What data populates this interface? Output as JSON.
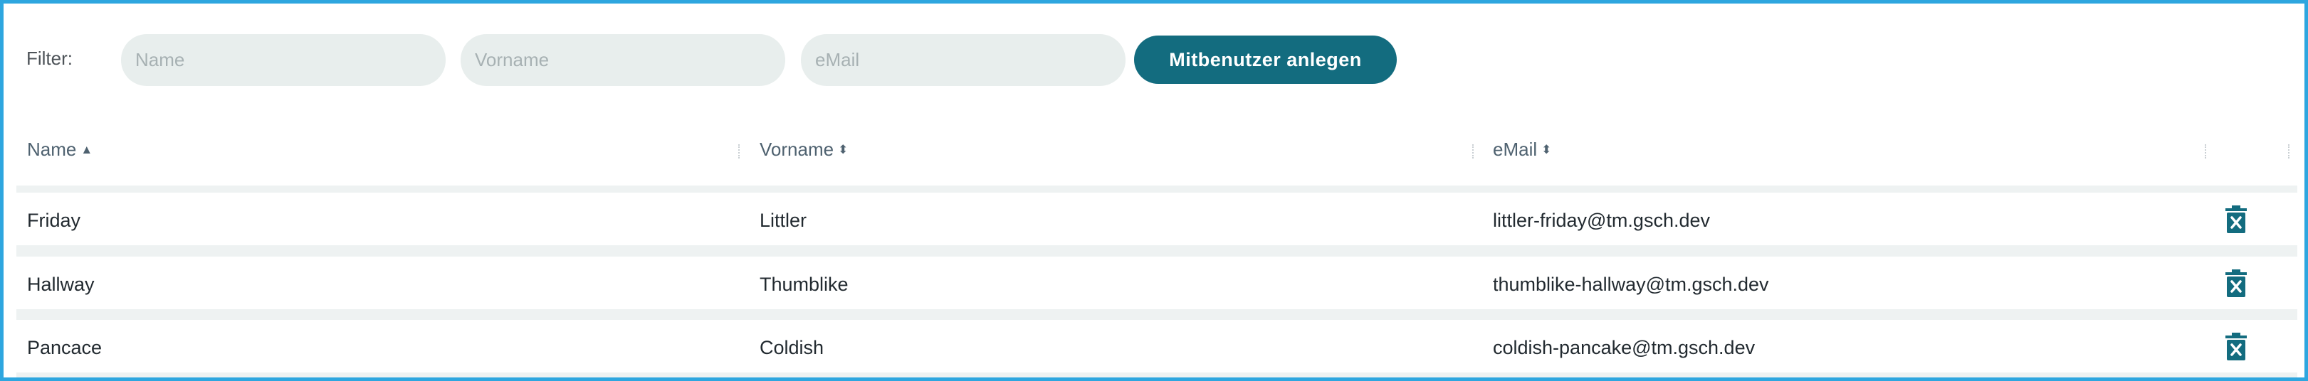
{
  "filter": {
    "label": "Filter:",
    "name_placeholder": "Name",
    "vorname_placeholder": "Vorname",
    "email_placeholder": "eMail",
    "create_button": "Mitbenutzer anlegen"
  },
  "colors": {
    "frame_border": "#2ea6df",
    "button_bg": "#136c7f",
    "input_bg": "#e8eeed",
    "delete_icon": "#136c7f"
  },
  "table": {
    "columns": [
      {
        "label": "Name",
        "sort_icon": "sort-ascending-icon"
      },
      {
        "label": "Vorname",
        "sort_icon": "sort-both-icon"
      },
      {
        "label": "eMail",
        "sort_icon": "sort-both-icon"
      }
    ],
    "rows": [
      {
        "name": "Friday",
        "vorname": "Littler",
        "email": "littler-friday@tm.gsch.dev",
        "action_icon": "trash-icon"
      },
      {
        "name": "Hallway",
        "vorname": "Thumblike",
        "email": "thumblike-hallway@tm.gsch.dev",
        "action_icon": "trash-icon"
      },
      {
        "name": "Pancace",
        "vorname": "Coldish",
        "email": "coldish-pancake@tm.gsch.dev",
        "action_icon": "trash-icon"
      }
    ]
  }
}
